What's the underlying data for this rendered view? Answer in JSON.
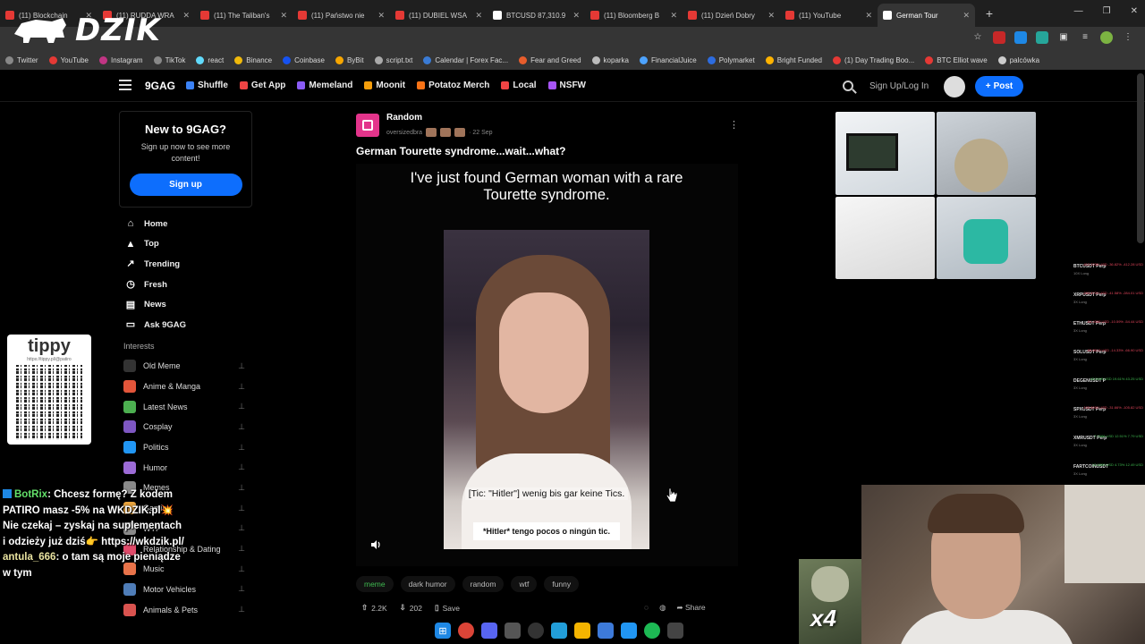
{
  "browser": {
    "tabs": [
      {
        "label": "(11) Blockchain",
        "color": "#e53935"
      },
      {
        "label": "(11) RUDDA WRA",
        "color": "#e53935"
      },
      {
        "label": "(11) The Taliban's",
        "color": "#e53935"
      },
      {
        "label": "(11) Państwo nie",
        "color": "#e53935"
      },
      {
        "label": "(11) DUBIEL WSA",
        "color": "#e53935"
      },
      {
        "label": "BTCUSD 87,310.9",
        "color": "#ffffff"
      },
      {
        "label": "(11) Bloomberg B",
        "color": "#e53935"
      },
      {
        "label": "(11) Dzień Dobry",
        "color": "#e53935"
      },
      {
        "label": "(11) YouTube",
        "color": "#e53935"
      },
      {
        "label": "German Tour",
        "color": "#ffffff",
        "active": true
      }
    ],
    "new_tab": "+",
    "window_controls": [
      "—",
      "❐",
      "✕"
    ],
    "bookmarks": [
      {
        "label": "Twitter",
        "color": "#888"
      },
      {
        "label": "YouTube",
        "color": "#e53935"
      },
      {
        "label": "Instagram",
        "color": "#c13584"
      },
      {
        "label": "TikTok",
        "color": "#888"
      },
      {
        "label": "react",
        "color": "#61dafb"
      },
      {
        "label": "Binance",
        "color": "#f0b90b"
      },
      {
        "label": "Coinbase",
        "color": "#1652f0"
      },
      {
        "label": "ByBit",
        "color": "#f7a600"
      },
      {
        "label": "script.txt",
        "color": "#aaa"
      },
      {
        "label": "Calendar | Forex Fac...",
        "color": "#3a7bd5"
      },
      {
        "label": "Fear and Greed",
        "color": "#e85d2c"
      },
      {
        "label": "koparka",
        "color": "#bbb"
      },
      {
        "label": "FinancialJuice",
        "color": "#4da3ff"
      },
      {
        "label": "Polymarket",
        "color": "#2d6cdf"
      },
      {
        "label": "Bright Funded",
        "color": "#ffb300"
      },
      {
        "label": "(1) Day Trading Boo...",
        "color": "#e53935"
      },
      {
        "label": "BTC Elliot wave",
        "color": "#e53935"
      },
      {
        "label": "palcówka",
        "color": "#ccc"
      }
    ]
  },
  "overlay": {
    "logo": "DZIK",
    "tippy": {
      "title": "tippy",
      "url": "https://tippy.pl/@patiro"
    },
    "chat": [
      {
        "user": "BotRix",
        "message": ": Chcesz formę? Z kodem PATIRO masz -5% na WKDZIK.pl💥 Nie czekaj – zyskaj na suplementach i odzieży już dziś👉 https://wkdzik.pl/"
      },
      {
        "user": "antula_666",
        "message": ": o tam są moje pieniądze w tym"
      }
    ],
    "multiplier": "x4"
  },
  "header": {
    "logo": "9GAG",
    "nav": [
      {
        "label": "Shuffle",
        "color": "#3b82f6"
      },
      {
        "label": "Get App",
        "color": "#ef4444"
      },
      {
        "label": "Memeland",
        "color": "#8b5cf6"
      },
      {
        "label": "Moonit",
        "color": "#f59e0b"
      },
      {
        "label": "Potatoz Merch",
        "color": "#f97316"
      },
      {
        "label": "Local",
        "color": "#ef4444"
      },
      {
        "label": "NSFW",
        "color": "#a855f7"
      }
    ],
    "signup": "Sign Up/Log In",
    "post_button": "Post"
  },
  "promo": {
    "title": "New to 9GAG?",
    "text": "Sign up now to see more content!",
    "button": "Sign up"
  },
  "side_nav": [
    {
      "label": "Home",
      "icon": "⌂"
    },
    {
      "label": "Top",
      "icon": "▲"
    },
    {
      "label": "Trending",
      "icon": "↗"
    },
    {
      "label": "Fresh",
      "icon": "◷"
    },
    {
      "label": "News",
      "icon": "▤"
    },
    {
      "label": "Ask 9GAG",
      "icon": "▭"
    }
  ],
  "interests_heading": "Interests",
  "interests": [
    {
      "label": "Old Meme",
      "color": "#333"
    },
    {
      "label": "Anime & Manga",
      "color": "#e2553a"
    },
    {
      "label": "Latest News",
      "color": "#4caf50"
    },
    {
      "label": "Cosplay",
      "color": "#7e57c2"
    },
    {
      "label": "Politics",
      "color": "#2196f3"
    },
    {
      "label": "Humor",
      "color": "#9c6bd6"
    },
    {
      "label": "Memes",
      "color": "#8a8a8a"
    },
    {
      "label": "Gaming",
      "color": "#e8a33d"
    },
    {
      "label": "WTF",
      "color": "#8a8a8a"
    },
    {
      "label": "Relationship & Dating",
      "color": "#e04b6a"
    },
    {
      "label": "Music",
      "color": "#e8734a"
    },
    {
      "label": "Motor Vehicles",
      "color": "#4f7db8"
    },
    {
      "label": "Animals & Pets",
      "color": "#d9534f"
    }
  ],
  "post": {
    "section": "Random",
    "author": "oversizedbra",
    "date": "· 22 Sep",
    "title": "German Tourette syndrome...wait...what?",
    "media_caption": "I've just found German woman with a rare Tourette syndrome.",
    "subtitle_de": "[Tic: \"Hitler\"] wenig bis gar keine Tics.",
    "subtitle_es": "*Hitler* tengo pocos o ningún tic.",
    "tags": [
      "meme",
      "dark humor",
      "random",
      "wtf",
      "funny"
    ],
    "upvotes": "2.2K",
    "comments": "202",
    "save": "Save",
    "share": "Share"
  },
  "crypto": [
    {
      "symbol": "BTCUSDT Perp",
      "sub": "10X Long",
      "value": "-412.2238 USD -36.82% -412.28 USD"
    },
    {
      "symbol": "XRPUSDT Perp",
      "sub": "3X Long",
      "value": "-283.8720 USD -41.58% -284.01 USD"
    },
    {
      "symbol": "ETHUSDT Perp",
      "sub": "3X Long",
      "value": "-54.4388 USD -10.59% -54.44 USD"
    },
    {
      "symbol": "SOLUSDT Perp",
      "sub": "3X Long",
      "value": "-66.8913 USD -14.33% -66.90 USD"
    },
    {
      "symbol": "DEGENUSDT P",
      "sub": "3X Long",
      "value": "43.2499 USD 19.61% 43.25 USD"
    },
    {
      "symbol": "SPXUSDT Perp",
      "sub": "3X Long",
      "value": "-105.8000 USD -31.66% -105.82 USD"
    },
    {
      "symbol": "XMRUSDT Perp",
      "sub": "3X Long",
      "value": "7.7888 USD 12.51% 7.79 USD"
    },
    {
      "symbol": "FARTCOINUSDT",
      "sub": "3X Long",
      "value": "12.4890 USD 4.73% 12.49 USD"
    }
  ]
}
